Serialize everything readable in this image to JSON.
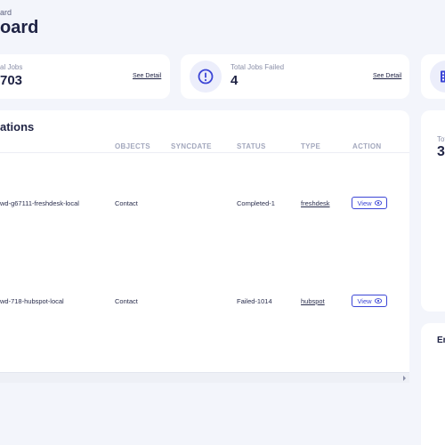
{
  "header": {
    "breadcrumb": "ard",
    "title": "oard"
  },
  "stats": [
    {
      "label": "al Jobs",
      "value": "703",
      "link": "See Detail"
    },
    {
      "label": "Total Jobs Failed",
      "value": "4",
      "link": "See Detail",
      "icon": "alert-circle-icon"
    },
    {
      "icon": "building-icon"
    }
  ],
  "integrations": {
    "title": "ations",
    "columns": [
      "OBJECTS",
      "SYNCDATE",
      "STATUS",
      "TYPE",
      "ACTION"
    ],
    "rows": [
      {
        "name": "wd-g67111-freshdesk-local",
        "object": "Contact",
        "syncdate": "",
        "status": "Completed-1",
        "type": "freshdesk",
        "action": "View"
      },
      {
        "name": "wd-718-hubspot-local",
        "object": "Contact",
        "syncdate": "",
        "status": "Failed-1014",
        "type": "hubspot",
        "action": "View"
      }
    ]
  },
  "side": {
    "label": "Tot",
    "value": "3",
    "bottom_title": "Er"
  },
  "colors": {
    "accent": "#3c46d6",
    "text": "#1f2344",
    "muted": "#8a8fa8",
    "bg": "#f3f5fb"
  }
}
